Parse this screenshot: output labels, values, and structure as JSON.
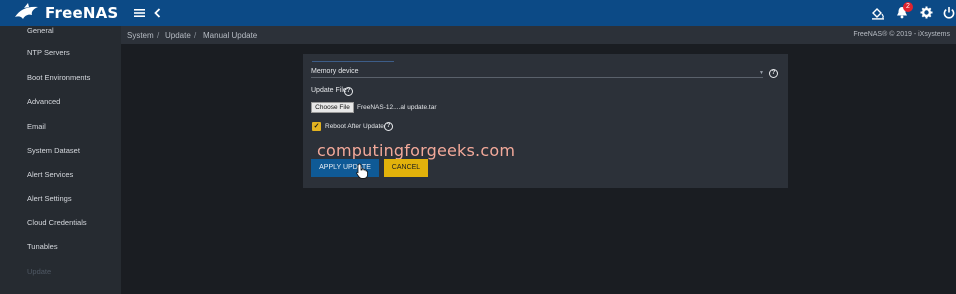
{
  "header": {
    "app_name": "FreeNAS",
    "notification_count": "2",
    "icons": [
      "hamburger-menu-icon",
      "chevron-left-icon",
      "task-manager-icon",
      "bell-icon",
      "gear-icon",
      "power-icon"
    ],
    "colors": {
      "header_bg": "#0c4a86",
      "badge": "#e0232e"
    }
  },
  "sidebar": {
    "items": [
      {
        "label": "General"
      },
      {
        "label": "NTP Servers"
      },
      {
        "label": "Boot Environments"
      },
      {
        "label": "Advanced"
      },
      {
        "label": "Email"
      },
      {
        "label": "System Dataset"
      },
      {
        "label": "Alert Services"
      },
      {
        "label": "Alert Settings"
      },
      {
        "label": "Cloud Credentials"
      },
      {
        "label": "Tunables"
      },
      {
        "label": "Update"
      }
    ]
  },
  "breadcrumb": {
    "items": [
      "System",
      "Update",
      "Manual Update"
    ],
    "separator": "/",
    "version": "FreeNAS® © 2019 - iXsystems"
  },
  "form": {
    "memory_device_label": "Memory device",
    "update_file_label": "Update File",
    "choose_file_label": "Choose File",
    "file_name": "FreeNAS-12....al update.tar",
    "reboot_label": "Reboot After Update",
    "reboot_checked": true,
    "apply_label": "APPLY UPDATE",
    "cancel_label": "CANCEL",
    "colors": {
      "apply": "#0f5a96",
      "cancel": "#e2b20b",
      "checkbox": "#e3b320"
    }
  },
  "watermark": {
    "text": "computingforgeeks.com"
  }
}
